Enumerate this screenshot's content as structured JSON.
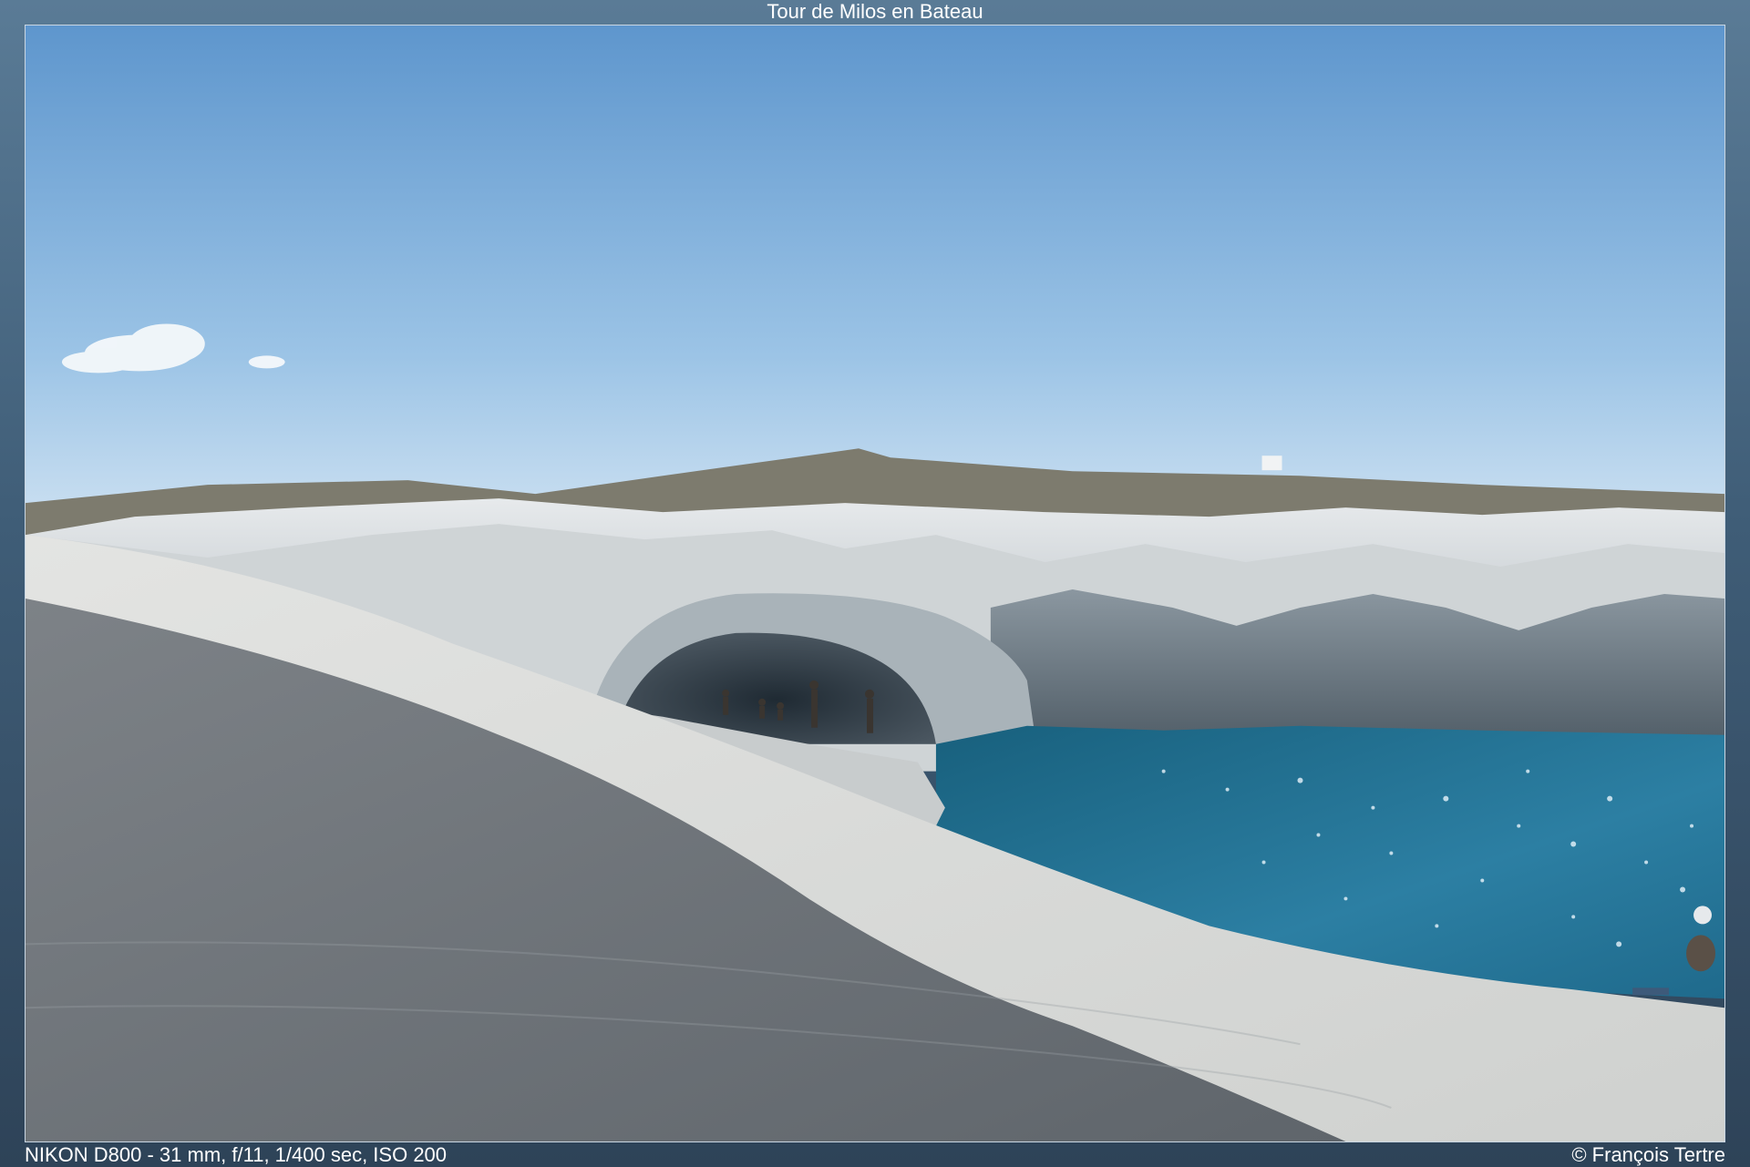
{
  "page": {
    "title": "Tour de Milos en Bateau",
    "exif": "NIKON D800 - 31 mm, f/11, 1/400 sec, ISO 200",
    "copyright": "© François Tertre"
  },
  "colors": {
    "sky_top": "#5d97cf",
    "sky_bottom": "#c6dbee",
    "sea": "#1f6f8e",
    "rock": "#d9dcdc",
    "rock_shadow": "#8a9096",
    "frame_bg": "#3f5d77"
  }
}
